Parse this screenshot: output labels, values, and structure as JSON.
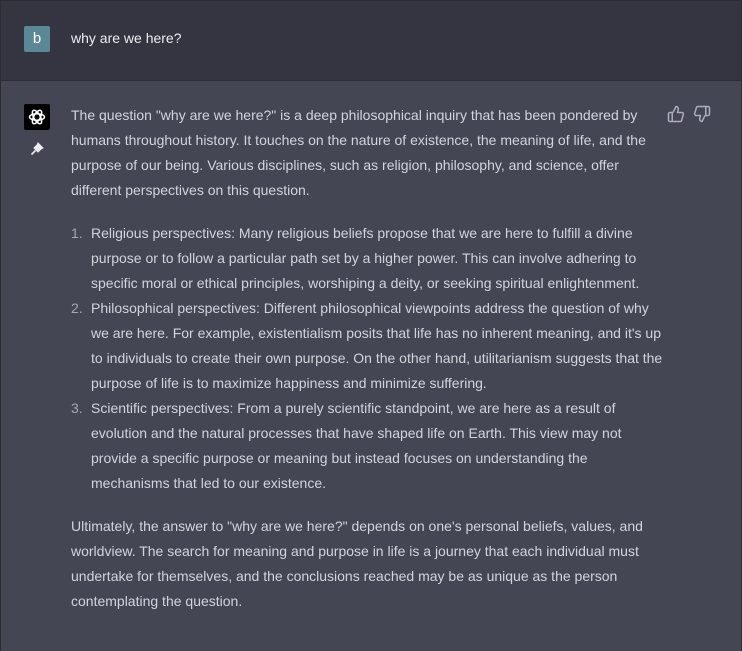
{
  "user_message": {
    "avatar_letter": "b",
    "text": "why are we here?"
  },
  "assistant_message": {
    "intro": "The question \"why are we here?\" is a deep philosophical inquiry that has been pondered by humans throughout history. It touches on the nature of existence, the meaning of life, and the purpose of our being. Various disciplines, such as religion, philosophy, and science, offer different perspectives on this question.",
    "list": [
      {
        "num": "1.",
        "text": "Religious perspectives: Many religious beliefs propose that we are here to fulfill a divine purpose or to follow a particular path set by a higher power. This can involve adhering to specific moral or ethical principles, worshiping a deity, or seeking spiritual enlightenment."
      },
      {
        "num": "2.",
        "text": "Philosophical perspectives: Different philosophical viewpoints address the question of why we are here. For example, existentialism posits that life has no inherent meaning, and it's up to individuals to create their own purpose. On the other hand, utilitarianism suggests that the purpose of life is to maximize happiness and minimize suffering."
      },
      {
        "num": "3.",
        "text": "Scientific perspectives: From a purely scientific standpoint, we are here as a result of evolution and the natural processes that have shaped life on Earth. This view may not provide a specific purpose or meaning but instead focuses on understanding the mechanisms that led to our existence."
      }
    ],
    "conclusion": "Ultimately, the answer to \"why are we here?\" depends on one's personal beliefs, values, and worldview. The search for meaning and purpose in life is a journey that each individual must undertake for themselves, and the conclusions reached may be as unique as the person contemplating the question."
  },
  "icons": {
    "bot_avatar": "openai-logo-icon",
    "pin": "pin-icon",
    "thumbs_up": "thumbs-up-icon",
    "thumbs_down": "thumbs-down-icon"
  },
  "colors": {
    "user_bg": "#343541",
    "assistant_bg": "#444654",
    "user_avatar": "#5a8896",
    "text": "#d1d5db"
  }
}
